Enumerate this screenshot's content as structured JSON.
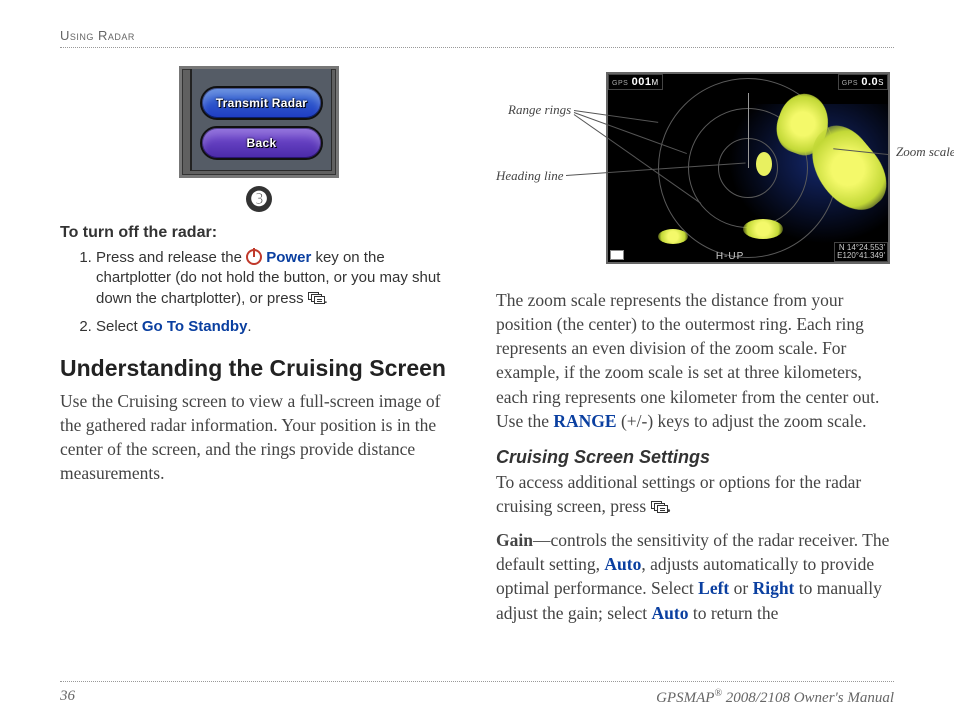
{
  "header": {
    "section": "Using Radar"
  },
  "device": {
    "button1": "Transmit Radar",
    "button2": "Back",
    "step_number": "➌"
  },
  "left": {
    "turnoff_heading": "To turn off the radar:",
    "step1a": "Press and release the ",
    "power_label": "Power",
    "step1b": " key on the chartplotter (do not hold the button, or you may shut down the chartplotter), or press ",
    "step1c": ".",
    "step2a": "Select ",
    "step2_link": "Go To Standby",
    "step2b": ".",
    "h2": "Understanding the Cruising Screen",
    "p1": "Use the Cruising screen to view a full-screen image of the gathered radar information. Your position is in the center of the screen, and the rings provide distance measurements."
  },
  "radar": {
    "topleft_label": "GPS",
    "topleft_value": "001",
    "topleft_unit": "M",
    "topright_label": "GPS",
    "topright_value": "0.0",
    "topright_unit": "S",
    "hup": "H-UP",
    "coords1": "N  14°24.553'",
    "coords2": "E120°41.349'",
    "callout_range": "Range rings",
    "callout_heading": "Heading line",
    "callout_zoom": "Zoom scale"
  },
  "right": {
    "p_zoom1": "The zoom scale represents the distance from your position (the center) to the outermost ring. Each ring represents an even division of the zoom scale. For example, if the zoom scale is set at three kilometers, each ring represents one kilometer from the center out. Use the ",
    "range_key": "RANGE",
    "p_zoom2": " (+/-) keys to adjust the zoom scale.",
    "h3": "Cruising Screen Settings",
    "p_access1": "To access additional settings or options for the radar cruising screen, press ",
    "p_access2": ".",
    "gain_label": "Gain",
    "gain_dash": "—",
    "gain_text1": "controls the sensitivity of the radar receiver. The default setting, ",
    "auto": "Auto",
    "gain_text2": ", adjusts automatically to provide optimal performance. Select ",
    "left_label": "Left",
    "or": " or ",
    "right_label": "Right",
    "gain_text3": " to manually adjust the gain; select ",
    "gain_text4": " to return the"
  },
  "footer": {
    "page": "36",
    "product": "GPSMAP",
    "reg": "®",
    "rest": " 2008/2108  Owner's Manual"
  }
}
